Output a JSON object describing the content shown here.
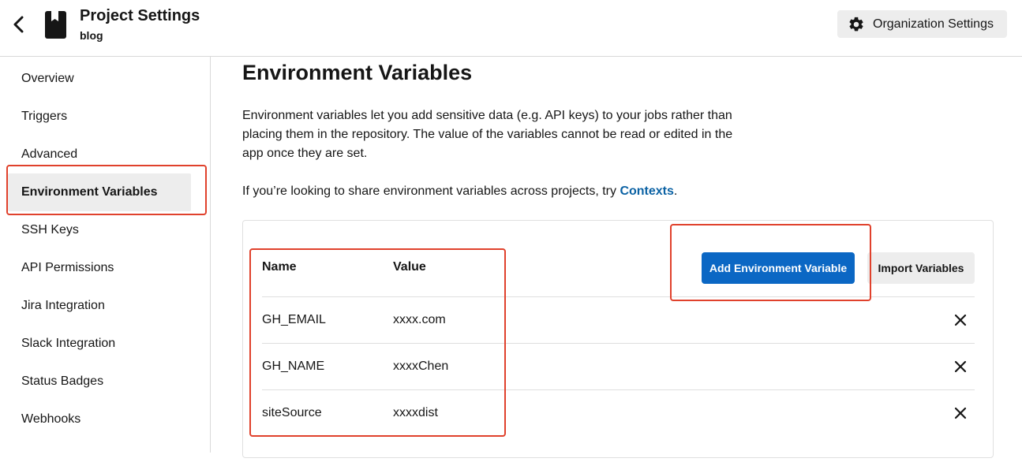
{
  "header": {
    "back_icon": "chevron-left-icon",
    "project_icon": "bookmark-icon",
    "title": "Project Settings",
    "subtitle": "blog",
    "org_button": {
      "icon": "gear-icon",
      "label": "Organization Settings"
    }
  },
  "sidebar": {
    "items": [
      {
        "label": "Overview",
        "active": false
      },
      {
        "label": "Triggers",
        "active": false
      },
      {
        "label": "Advanced",
        "active": false
      },
      {
        "label": "Environment Variables",
        "active": true
      },
      {
        "label": "SSH Keys",
        "active": false
      },
      {
        "label": "API Permissions",
        "active": false
      },
      {
        "label": "Jira Integration",
        "active": false
      },
      {
        "label": "Slack Integration",
        "active": false
      },
      {
        "label": "Status Badges",
        "active": false
      },
      {
        "label": "Webhooks",
        "active": false
      }
    ]
  },
  "main": {
    "title": "Environment Variables",
    "description": "Environment variables let you add sensitive data (e.g. API keys) to your jobs rather than placing them in the repository. The value of the variables cannot be read or edited in the app once they are set.",
    "share_text": "If you’re looking to share environment variables across projects, try ",
    "share_link": "Contexts",
    "share_suffix": ".",
    "add_button": "Add Environment Variable",
    "import_button": "Import Variables",
    "table": {
      "headers": [
        "Name",
        "Value"
      ],
      "rows": [
        {
          "name": "GH_EMAIL",
          "value": "xxxx.com"
        },
        {
          "name": "GH_NAME",
          "value": "xxxxChen"
        },
        {
          "name": "siteSource",
          "value": "xxxxdist"
        }
      ],
      "delete_icon": "close-icon"
    }
  },
  "colors": {
    "primary": "#0b67c4",
    "link": "#0b62a4",
    "highlight": "#e0412c",
    "active_bg": "#ededed"
  }
}
